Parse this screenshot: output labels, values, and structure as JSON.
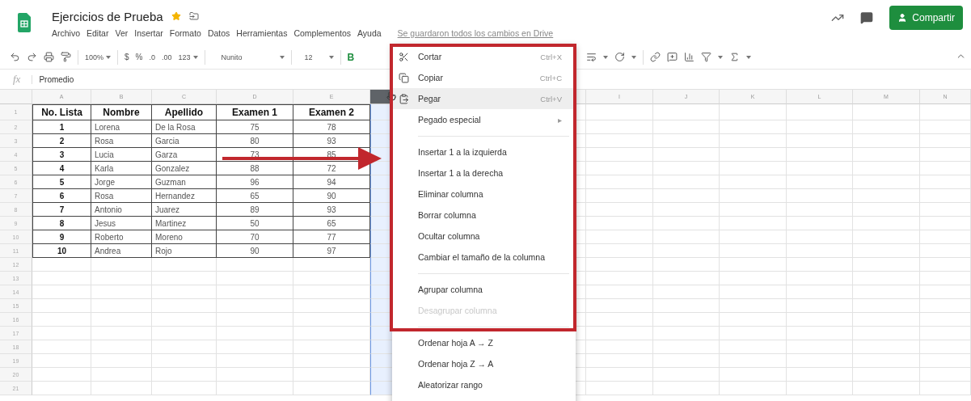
{
  "document": {
    "title": "Ejercicios de Prueba",
    "starred": true
  },
  "menu_bar": [
    "Archivo",
    "Editar",
    "Ver",
    "Insertar",
    "Formato",
    "Datos",
    "Herramientas",
    "Complementos",
    "Ayuda"
  ],
  "save_status": "Se guardaron todos los cambios en Drive",
  "share_button": {
    "label": "Compartir"
  },
  "toolbar": {
    "zoom": "100%",
    "currency": "$",
    "percent": "%",
    "decrease_decimals": ".0",
    "increase_decimals": ".00",
    "number_format": "123",
    "font": "Nunito",
    "font_size": "12",
    "bold": "B"
  },
  "formula_bar": {
    "label": "fx",
    "value": "Promedio"
  },
  "columns_left": [
    {
      "label": "A",
      "selected": false
    },
    {
      "label": "B",
      "selected": false
    },
    {
      "label": "C",
      "selected": false
    },
    {
      "label": "D",
      "selected": false
    },
    {
      "label": "E",
      "selected": false
    },
    {
      "selected": true
    }
  ],
  "columns_right": [
    {
      "label": "I",
      "selected": false
    },
    {
      "label": "J",
      "selected": false
    },
    {
      "label": "K",
      "selected": false
    },
    {
      "label": "L",
      "selected": false
    },
    {
      "label": "M",
      "selected": false
    },
    {
      "label": "N",
      "selected": false
    }
  ],
  "row_numbers": [
    "1",
    "2",
    "3",
    "4",
    "5",
    "6",
    "7",
    "8",
    "9",
    "10",
    "11",
    "12",
    "13",
    "14",
    "15",
    "16",
    "17",
    "18",
    "19",
    "20",
    "21"
  ],
  "table": {
    "header": [
      "No. Lista",
      "Nombre",
      "Apellido",
      "Examen 1",
      "Examen 2"
    ],
    "rows": [
      [
        "1",
        "Lorena",
        "De la Rosa",
        "75",
        "78"
      ],
      [
        "2",
        "Rosa",
        "Garcia",
        "80",
        "93"
      ],
      [
        "3",
        "Lucia",
        "Garza",
        "73",
        "85"
      ],
      [
        "4",
        "Karla",
        "Gonzalez",
        "88",
        "72"
      ],
      [
        "5",
        "Jorge",
        "Guzman",
        "96",
        "94"
      ],
      [
        "6",
        "Rosa",
        "Hernandez",
        "65",
        "90"
      ],
      [
        "7",
        "Antonio",
        "Juarez",
        "89",
        "93"
      ],
      [
        "8",
        "Jesus",
        "Martinez",
        "50",
        "65"
      ],
      [
        "9",
        "Roberto",
        "Moreno",
        "70",
        "77"
      ],
      [
        "10",
        "Andrea",
        "Rojo",
        "90",
        "97"
      ]
    ]
  },
  "context_menu": {
    "items": [
      {
        "kind": "item",
        "label": "Cortar",
        "shortcut": "Ctrl+X",
        "highlighted": false,
        "disabled": false
      },
      {
        "kind": "item",
        "label": "Copiar",
        "shortcut": "Ctrl+C",
        "highlighted": false,
        "disabled": false
      },
      {
        "kind": "item",
        "label": "Pegar",
        "shortcut": "Ctrl+V",
        "highlighted": true,
        "disabled": false
      },
      {
        "kind": "submenu",
        "label": "Pegado especial",
        "arrow": "▸",
        "highlighted": false,
        "disabled": false
      },
      {
        "kind": "divider"
      },
      {
        "kind": "item",
        "label": "Insertar 1 a la izquierda",
        "highlighted": false,
        "disabled": false
      },
      {
        "kind": "item",
        "label": "Insertar 1 a la derecha",
        "highlighted": false,
        "disabled": false
      },
      {
        "kind": "item",
        "label": "Eliminar columna",
        "highlighted": false,
        "disabled": false
      },
      {
        "kind": "item",
        "label": "Borrar columna",
        "highlighted": false,
        "disabled": false
      },
      {
        "kind": "item",
        "label": "Ocultar columna",
        "highlighted": false,
        "disabled": false
      },
      {
        "kind": "item",
        "label": "Cambiar el tamaño de la columna",
        "highlighted": false,
        "disabled": false
      },
      {
        "kind": "divider"
      },
      {
        "kind": "item",
        "label": "Agrupar columna",
        "highlighted": false,
        "disabled": false
      },
      {
        "kind": "item",
        "label": "Desagrupar columna",
        "highlighted": false,
        "disabled": true
      },
      {
        "kind": "divider"
      },
      {
        "kind": "item",
        "label": "Ordenar hoja A → Z",
        "highlighted": false,
        "disabled": false
      },
      {
        "kind": "item",
        "label": "Ordenar hoja Z → A",
        "highlighted": false,
        "disabled": false
      },
      {
        "kind": "item",
        "label": "Aleatorizar rango",
        "highlighted": false,
        "disabled": false
      }
    ]
  }
}
